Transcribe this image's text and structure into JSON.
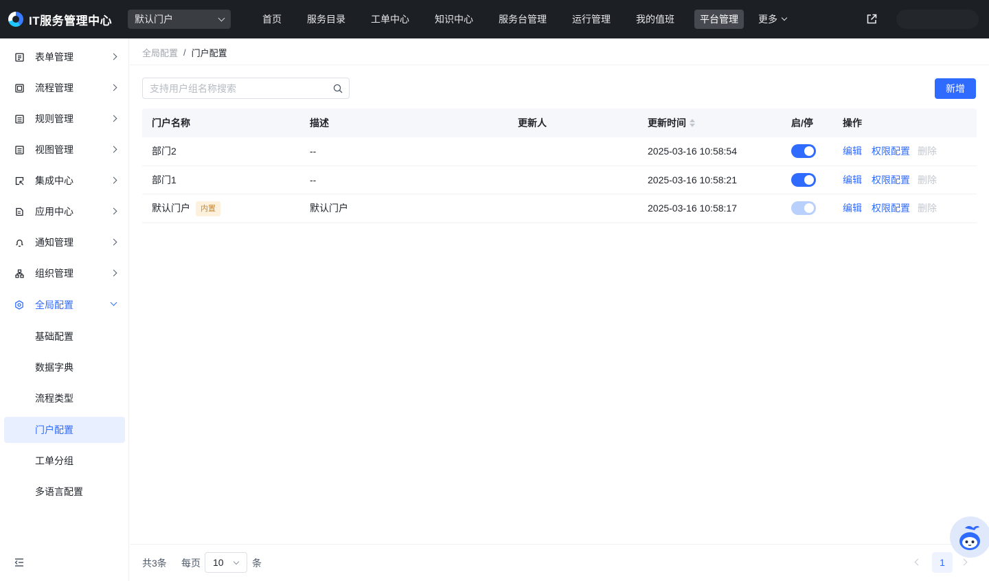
{
  "app": {
    "title": "IT服务管理中心"
  },
  "header": {
    "portal_select": "默认门户",
    "nav": [
      "首页",
      "服务目录",
      "工单中心",
      "知识中心",
      "服务台管理",
      "运行管理",
      "我的值班",
      "平台管理"
    ],
    "nav_active": "平台管理",
    "more_label": "更多"
  },
  "sidebar": {
    "items": [
      {
        "label": "表单管理",
        "icon": "form-icon"
      },
      {
        "label": "流程管理",
        "icon": "flow-icon"
      },
      {
        "label": "规则管理",
        "icon": "rule-icon"
      },
      {
        "label": "视图管理",
        "icon": "view-icon"
      },
      {
        "label": "集成中心",
        "icon": "integration-icon"
      },
      {
        "label": "应用中心",
        "icon": "app-icon"
      },
      {
        "label": "通知管理",
        "icon": "bell-icon"
      },
      {
        "label": "组织管理",
        "icon": "org-icon"
      },
      {
        "label": "全局配置",
        "icon": "settings-icon"
      }
    ],
    "sub_items": [
      "基础配置",
      "数据字典",
      "流程类型",
      "门户配置",
      "工单分组",
      "多语言配置"
    ],
    "active_sub": "门户配置",
    "accent": "#2f6bff"
  },
  "breadcrumb": {
    "parent": "全局配置",
    "separator": "/",
    "current": "门户配置"
  },
  "search": {
    "placeholder": "支持用户组名称搜索",
    "value": ""
  },
  "toolbar": {
    "add_label": "新增"
  },
  "table": {
    "headers": {
      "name": "门户名称",
      "desc": "描述",
      "updater": "更新人",
      "time": "更新时间",
      "toggle": "启/停",
      "ops": "操作"
    },
    "rows": [
      {
        "name": "部门2",
        "tag": "",
        "desc": "--",
        "updater": "",
        "time": "2025-03-16 10:58:54",
        "enabled": true,
        "toggle_disabled": false,
        "ops": [
          "编辑",
          "权限配置",
          "删除"
        ]
      },
      {
        "name": "部门1",
        "tag": "",
        "desc": "--",
        "updater": "",
        "time": "2025-03-16 10:58:21",
        "enabled": true,
        "toggle_disabled": false,
        "ops": [
          "编辑",
          "权限配置",
          "删除"
        ]
      },
      {
        "name": "默认门户",
        "tag": "内置",
        "desc": "默认门户",
        "updater": "",
        "time": "2025-03-16 10:58:17",
        "enabled": true,
        "toggle_disabled": true,
        "ops": [
          "编辑",
          "权限配置",
          "删除"
        ]
      }
    ]
  },
  "pagination": {
    "total": "共3条",
    "per_page_label": "每页",
    "page_size": "10",
    "unit": "条",
    "current_page": "1"
  }
}
